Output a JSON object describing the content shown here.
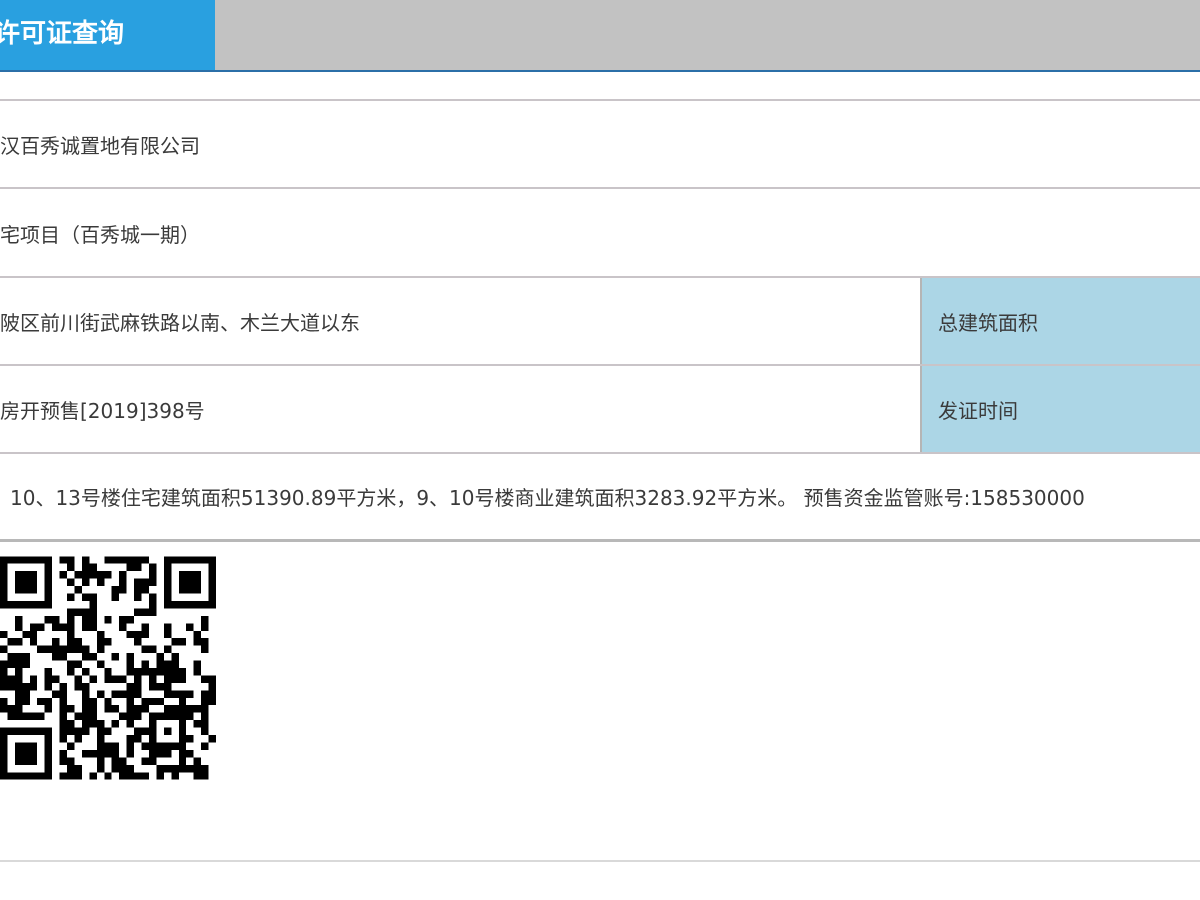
{
  "tabs": {
    "active_label": "许可证查询"
  },
  "info": {
    "developer": "汉百秀诚置地有限公司",
    "project": "宅项目（百秀城一期）",
    "location": "陂区前川街武麻铁路以南、木兰大道以东",
    "location_label": "总建筑面积",
    "permit_no": "房开预售[2019]398号",
    "permit_label": "发证时间",
    "remarks": "10、13号楼住宅建筑面积51390.89平方米，9、10号楼商业建筑面积3283.92平方米。 预售资金监管账号:158530000"
  },
  "qr_code": {
    "icon": "qr-code-icon"
  },
  "colors": {
    "tab_active": "#29a0e0",
    "tab_bar": "#c2c2c2",
    "label_cell": "#acd6e6"
  }
}
